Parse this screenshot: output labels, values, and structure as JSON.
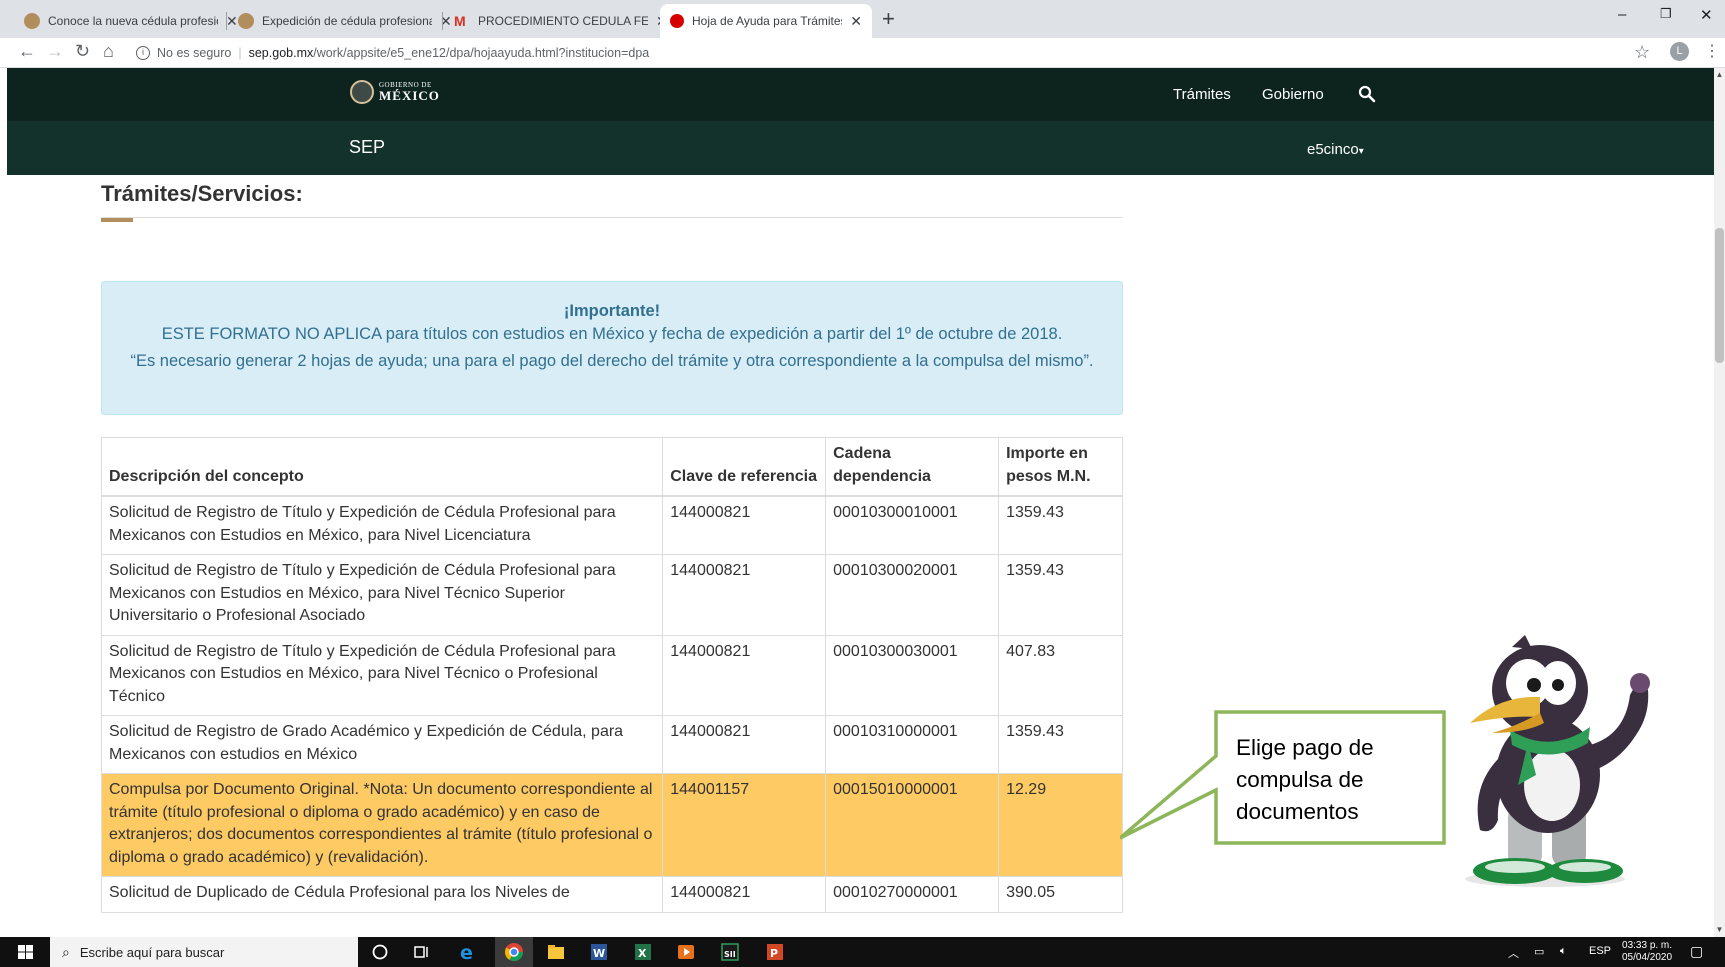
{
  "browser": {
    "tabs": [
      {
        "title": "Conoce la nueva cédula profesio",
        "active": false,
        "favicon_color": "#b38e5d"
      },
      {
        "title": "Expedición de cédula profesional",
        "active": false,
        "favicon_color": "#b38e5d"
      },
      {
        "title": "PROCEDIMIENTO CEDULA FEDER",
        "active": false,
        "favicon_color": "#d93025"
      },
      {
        "title": "Hoja de Ayuda para Trámites y S",
        "active": true,
        "favicon_color": "#d50000"
      }
    ],
    "new_tab_label": "+",
    "security_label": "No es seguro",
    "url_host": "sep.gob.mx",
    "url_path": "/work/appsite/e5_ene12/dpa/hojaayuda.html?institucion=dpa",
    "profile_initial": "L"
  },
  "header": {
    "logo_line1": "GOBIERNO DE",
    "logo_line2": "MÉXICO",
    "nav": [
      "Trámites",
      "Gobierno"
    ],
    "sub_title": "SEP",
    "menu_label": "e5cinco"
  },
  "main": {
    "section_title": "Trámites/Servicios:",
    "alert": {
      "heading": "¡Importante!",
      "line1": "ESTE FORMATO NO APLICA para títulos con estudios en México y fecha de expedición a partir del 1º de octubre de 2018.",
      "line2": "“Es necesario generar 2 hojas de ayuda; una para el pago del derecho del trámite y otra correspondiente a la compulsa del mismo”."
    },
    "table": {
      "headers": [
        "Descripción del concepto",
        "Clave de referencia",
        "Cadena dependencia",
        "Importe en pesos M.N."
      ],
      "rows": [
        [
          "Solicitud de Registro de Título y Expedición de Cédula Profesional para Mexicanos con Estudios en México, para Nivel Licenciatura",
          "144000821",
          "00010300010001",
          "1359.43"
        ],
        [
          "Solicitud de Registro de Título y Expedición de Cédula Profesional para Mexicanos con Estudios en México, para Nivel Técnico Superior Universitario o Profesional Asociado",
          "144000821",
          "00010300020001",
          "1359.43"
        ],
        [
          "Solicitud de Registro de Título y Expedición de Cédula Profesional para Mexicanos con Estudios en México, para Nivel Técnico o Profesional Técnico",
          "144000821",
          "00010300030001",
          "407.83"
        ],
        [
          "Solicitud de Registro de Grado Académico y Expedición de Cédula, para Mexicanos con estudios en México",
          "144000821",
          "00010310000001",
          "1359.43"
        ],
        [
          "Compulsa por Documento Original. *Nota: Un documento correspondiente al trámite (título profesional o diploma o grado académico) y en caso de extranjeros; dos documentos correspondientes al trámite (título profesional o diploma o grado académico) y (revalidación).",
          "144001157",
          "00015010000001",
          "12.29"
        ],
        [
          "Solicitud de Duplicado de Cédula Profesional para los Niveles de",
          "144000821",
          "00010270000001",
          "390.05"
        ]
      ],
      "highlighted_row": 4,
      "highlight_color": "#fdca64"
    }
  },
  "callout": {
    "text": "Elige pago de compulsa de documentos",
    "border_color": "#8db65a"
  },
  "taskbar": {
    "search_placeholder": "Escribe aquí para buscar",
    "language": "ESP",
    "time": "03:33 p. m.",
    "date": "05/04/2020"
  },
  "colors": {
    "header_dark": "#0c231e",
    "header_sep": "#13322b",
    "accent": "#b38e5d",
    "alert_bg": "#d9edf7",
    "alert_text": "#31708f"
  }
}
